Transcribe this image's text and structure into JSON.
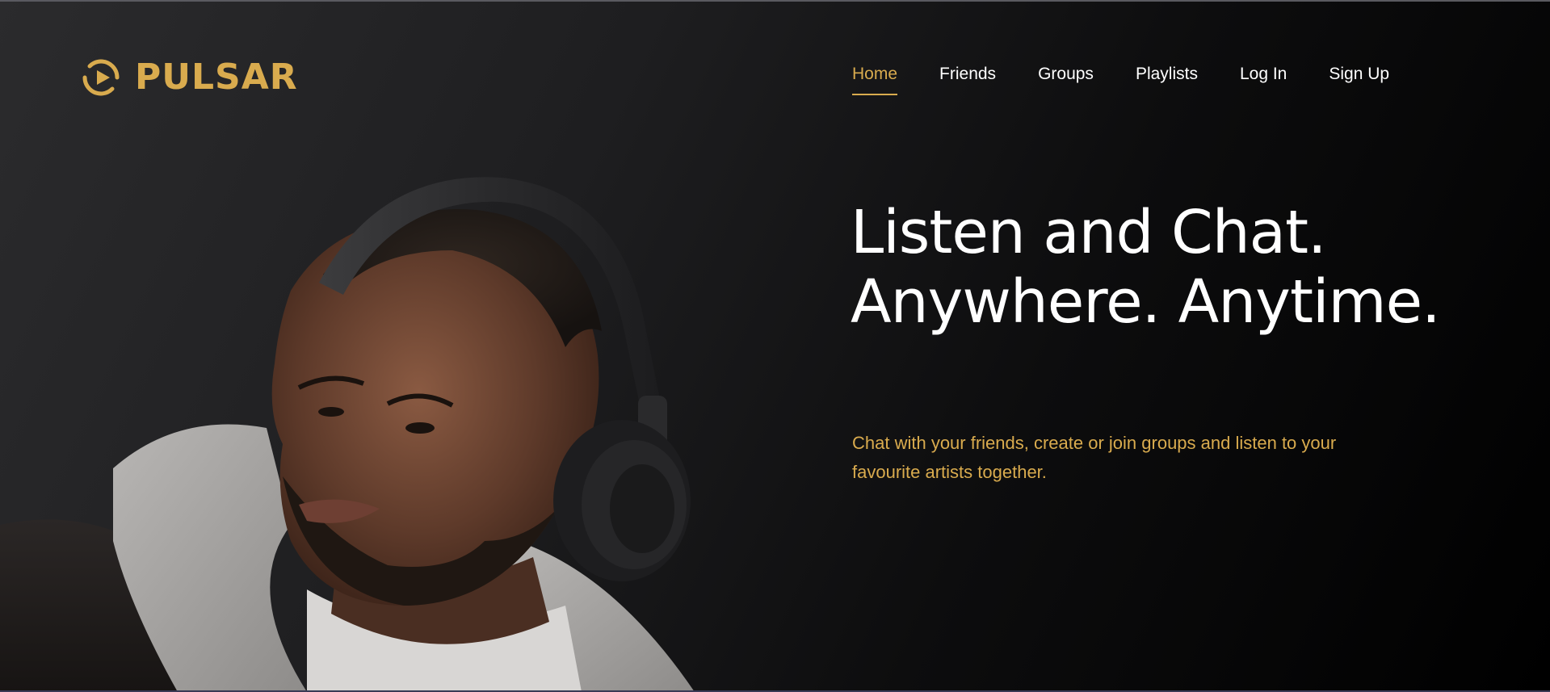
{
  "brand": {
    "name": "PULSAR",
    "logo_icon": "play-circle-logo-icon",
    "accent_color": "#d9ab4e"
  },
  "nav": {
    "items": [
      {
        "label": "Home",
        "active": true
      },
      {
        "label": "Friends",
        "active": false
      },
      {
        "label": "Groups",
        "active": false
      },
      {
        "label": "Playlists",
        "active": false
      },
      {
        "label": "Log In",
        "active": false
      },
      {
        "label": "Sign Up",
        "active": false
      }
    ]
  },
  "hero": {
    "headline_line1": "Listen and Chat.",
    "headline_line2": "Anywhere. Anytime.",
    "subtext": "Chat with your friends, create or join groups and listen to your favourite artists together."
  },
  "colors": {
    "background_start": "#2b2b2d",
    "background_end": "#000000",
    "text_primary": "#ffffff",
    "accent": "#d9ab4e"
  }
}
